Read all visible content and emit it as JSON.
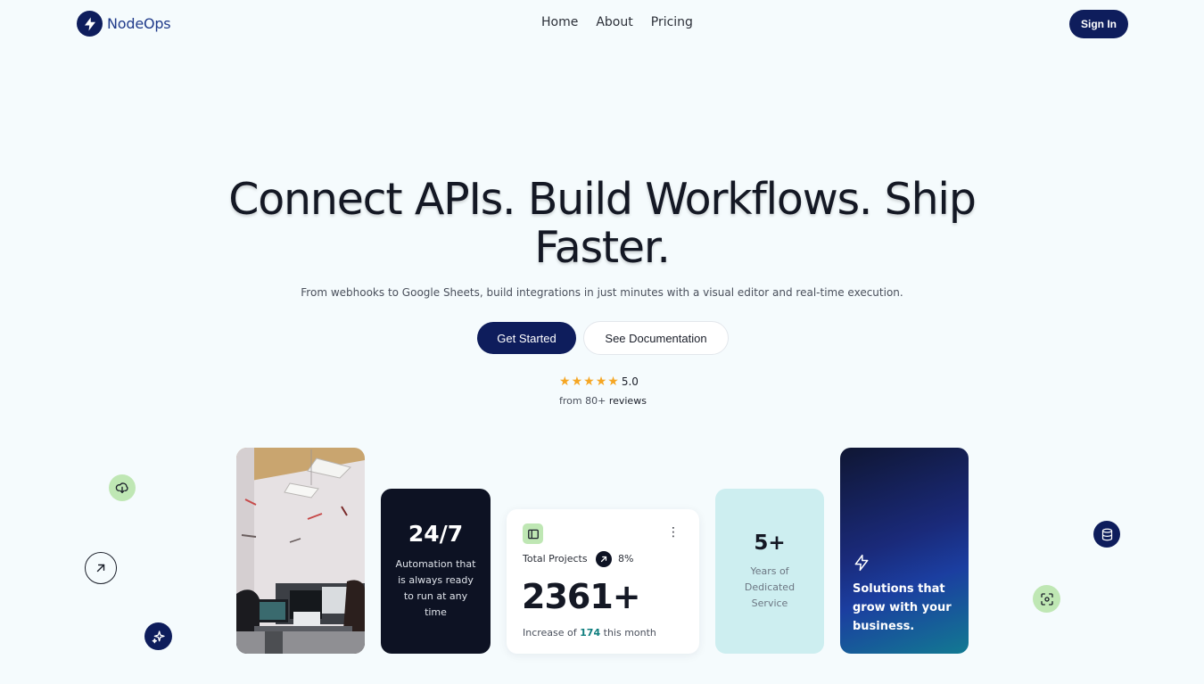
{
  "brand": {
    "name": "NodeOps",
    "icon": "bolt-icon"
  },
  "nav": {
    "links": [
      {
        "label": "Home"
      },
      {
        "label": "About"
      },
      {
        "label": "Pricing"
      }
    ],
    "signin_label": "Sign In"
  },
  "hero": {
    "title": "Connect APIs. Build Workflows. Ship Faster.",
    "subtitle": "From webhooks to Google Sheets, build integrations in just minutes with a visual editor and real-time execution.",
    "primary_cta": "Get Started",
    "secondary_cta": "See Documentation",
    "rating": {
      "stars": 5,
      "value": "5.0",
      "reviews_prefix": "from 80+",
      "reviews_label": "reviews"
    }
  },
  "cards": {
    "uptime": {
      "big": "24/7",
      "text": "Automation that is always ready to run at any time"
    },
    "stats": {
      "label": "Total Projects",
      "percent": "8%",
      "number": "2361+",
      "increase_prefix": "Increase of",
      "increase_value": "174",
      "increase_suffix": "this month"
    },
    "years": {
      "big": "5+",
      "text": "Years of Dedicated Service"
    },
    "solutions": {
      "text": "Solutions that grow with your business."
    }
  },
  "colors": {
    "navy": "#0e1d5c",
    "mint": "#bfe7b4",
    "star": "#f5a623",
    "teal": "#0f7e7e",
    "background": "#f5fbfd"
  }
}
